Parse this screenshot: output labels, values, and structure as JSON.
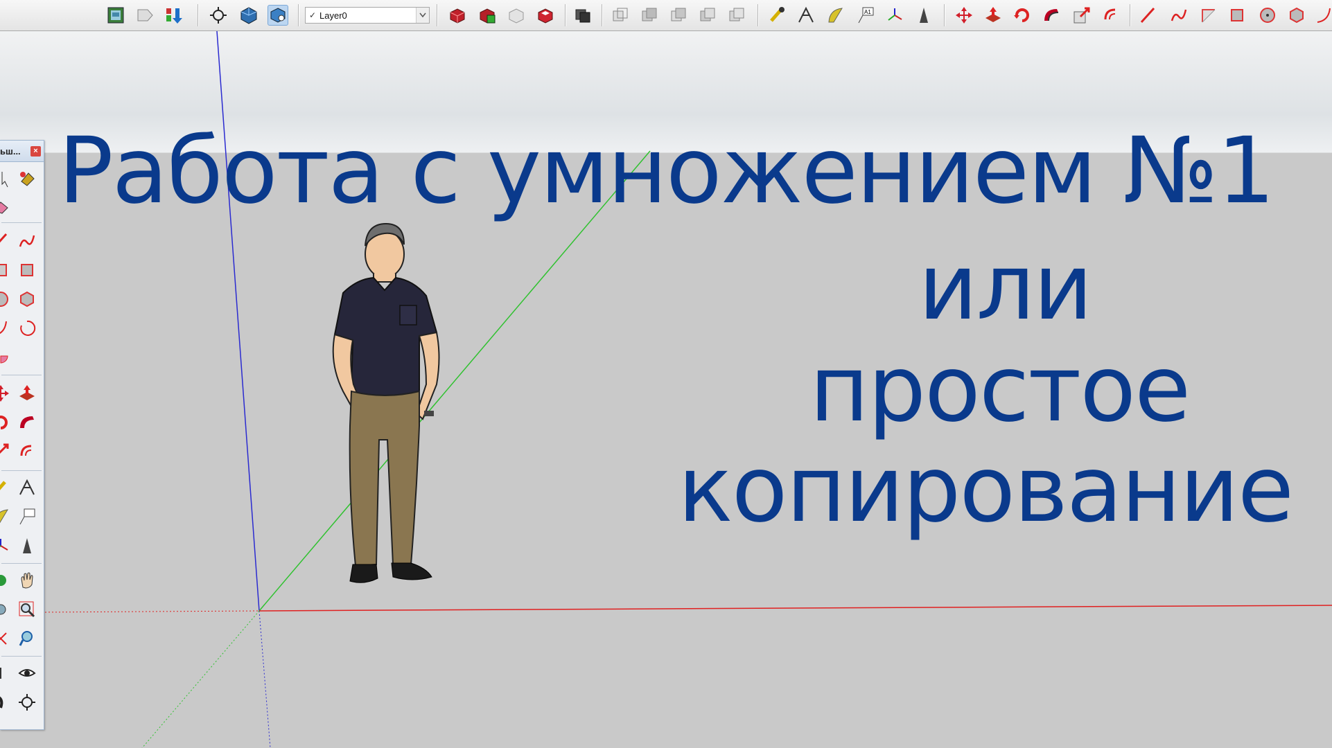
{
  "toolbar": {
    "layer": {
      "checked": "✓",
      "name": "Layer0"
    },
    "icons": [
      "model-info-icon",
      "tag-icon",
      "download-icon",
      "orbit-icon",
      "component-icon",
      "component-options-icon",
      "solid-union-icon",
      "solid-subtract-icon",
      "solid-trim-icon",
      "solid-shell-icon",
      "section-plane-icon",
      "view-iso-icon",
      "view-top-icon",
      "view-front-icon",
      "view-right-icon",
      "view-back-icon",
      "tape-measure-icon",
      "dimension-icon",
      "protractor-icon",
      "text-icon",
      "axes-icon",
      "3d-text-icon",
      "move-icon",
      "push-pull-icon",
      "rotate-icon",
      "follow-me-icon",
      "scale-icon",
      "offset-icon",
      "pencil-icon",
      "freehand-icon",
      "rectangle-icon",
      "rotated-rectangle-icon",
      "circle-icon",
      "polygon-icon",
      "arc-icon"
    ]
  },
  "palette": {
    "title": "ьш...",
    "close": "×"
  },
  "title": {
    "line1": "Работа с умножением №1",
    "line2": "или",
    "line3": "простое",
    "line4": "копирование"
  },
  "colors": {
    "title": "#0a3a8c",
    "axis_red": "#d22",
    "axis_green": "#2c2",
    "axis_blue": "#22c",
    "sky": "#e6e9ec",
    "ground": "#c9c9c9"
  }
}
